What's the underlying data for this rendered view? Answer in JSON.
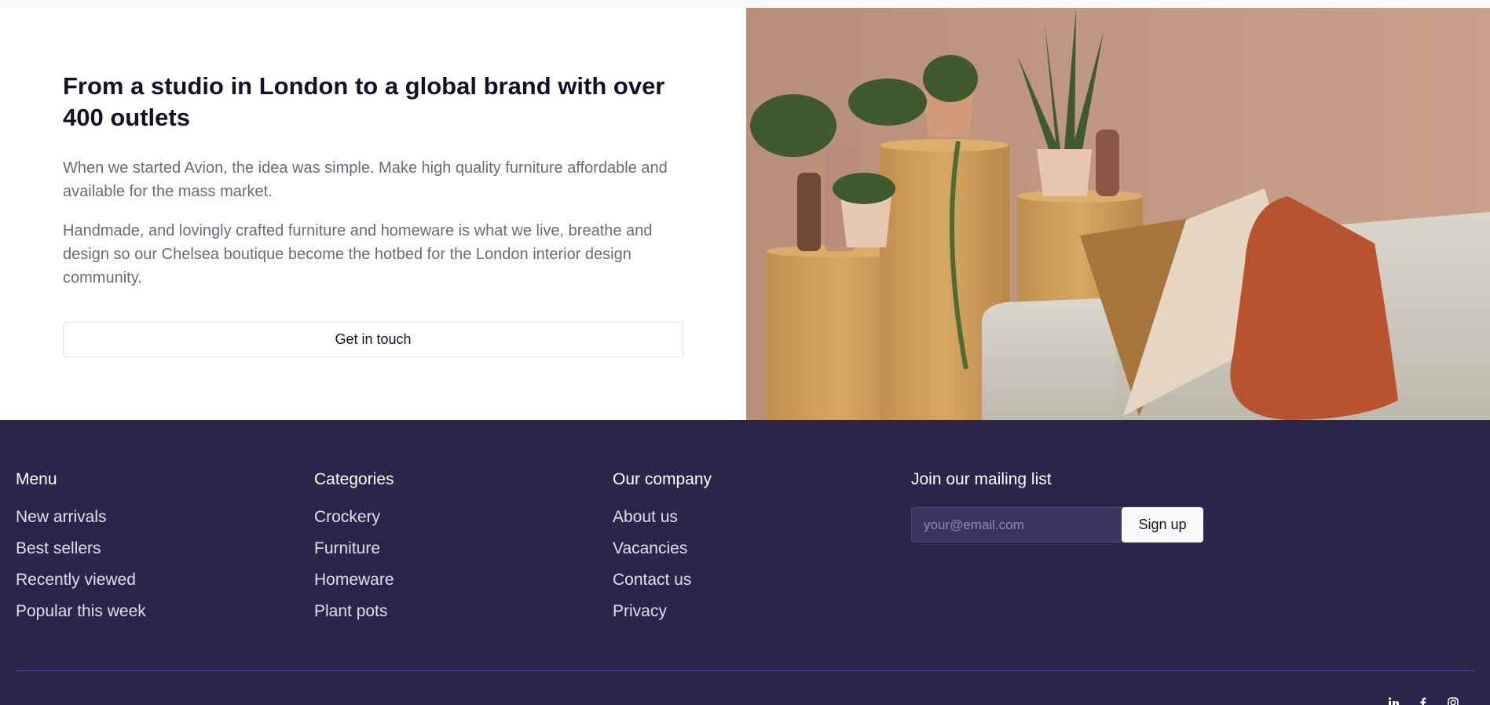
{
  "about": {
    "heading": "From a studio in London to a global brand with over 400 outlets",
    "paragraph1": "When we started Avion, the idea was simple. Make high quality furniture affordable and available for the mass market.",
    "paragraph2": "Handmade, and lovingly crafted furniture and homeware is what we live, breathe and design so our Chelsea boutique become the hotbed for the London interior design community.",
    "cta_label": "Get in touch",
    "image_alt": "living-room-image"
  },
  "footer": {
    "menu": {
      "title": "Menu",
      "items": [
        "New arrivals",
        "Best sellers",
        "Recently viewed",
        "Popular this week"
      ]
    },
    "categories": {
      "title": "Categories",
      "items": [
        "Crockery",
        "Furniture",
        "Homeware",
        "Plant pots"
      ]
    },
    "company": {
      "title": "Our company",
      "items": [
        "About us",
        "Vacancies",
        "Contact us",
        "Privacy"
      ]
    },
    "mailing": {
      "title": "Join our mailing list",
      "placeholder": "your@email.com",
      "button_label": "Sign up"
    }
  },
  "colors": {
    "footer_bg": "#2a254b",
    "heading_text": "#12112a",
    "body_text": "#6b6a78",
    "wall": "#c19882"
  }
}
